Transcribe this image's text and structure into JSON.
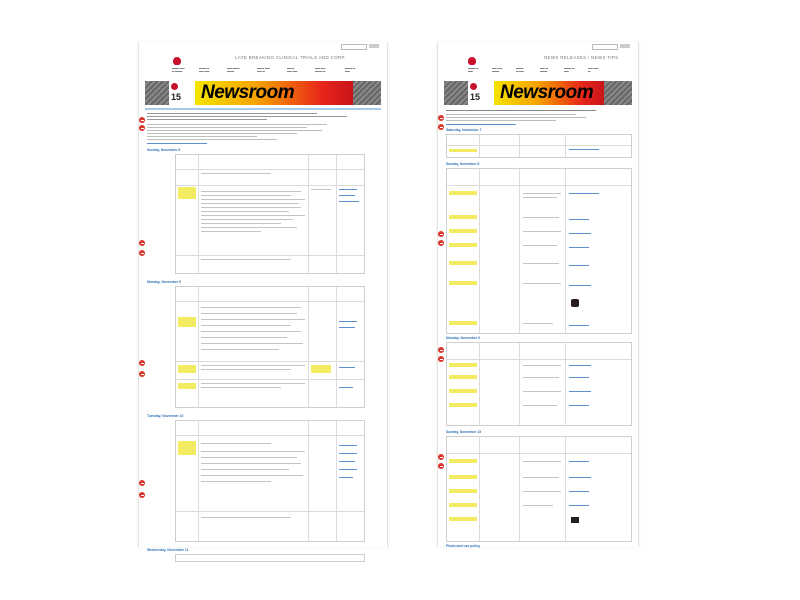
{
  "left": {
    "heading": "LATE BREAKING CLINICAL TRIALS AND CORP",
    "banner_word": "Newsroom",
    "banner_year": "15",
    "days": [
      "Sunday, November 8",
      "Monday, November 9",
      "Tuesday, November 10",
      "Wednesday, November 11"
    ]
  },
  "right": {
    "heading": "NEWS RELEASES / NEWS TIPS",
    "banner_word": "Newsroom",
    "banner_year": "15",
    "days": [
      "Saturday, November 7",
      "Sunday, November 8",
      "Monday, November 9",
      "Sunday, November 15"
    ],
    "footer_link": "Photo and use policy"
  }
}
